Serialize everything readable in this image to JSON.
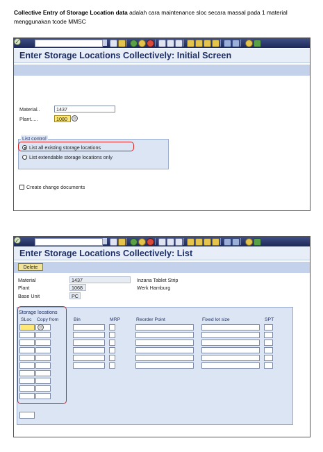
{
  "intro": {
    "bold": "Collective Entry of Storage Location data",
    "rest": " adalah cara maintenance sloc secara massal pada 1 material menggunakan tcode MMSC"
  },
  "screen1": {
    "title": "Enter Storage Locations Collectively: Initial Screen",
    "material_label": "Material..",
    "material_value": "1437",
    "plant_label": "Plant.....",
    "plant_value": "1080",
    "list_control_title": "List control",
    "option_existing": "List all existing storage locations",
    "option_extendable": "List extendable storage locations only",
    "option_selected": "existing",
    "create_change_docs": "Create change documents"
  },
  "screen2": {
    "title": "Enter Storage Locations Collectively: List",
    "delete_button": "Delete",
    "material_label": "Material",
    "material_value": "1437",
    "material_desc": "Inzana Tablet Strip",
    "plant_label": "Plant",
    "plant_value": "1068",
    "plant_desc": "Werk Hamburg",
    "base_unit_label": "Base Unit",
    "base_unit_value": "PC",
    "storage_locations_title": "Storage locations",
    "columns": {
      "sloc": "SLoc",
      "copy_from": "Copy from",
      "bin": "Bin",
      "mrp": "MRP",
      "reorder_point": "Reorder Point",
      "fixed_lot_size": "Fixed lot size",
      "spt": "SPT"
    }
  },
  "toolbar_icons": [
    "enter-icon",
    "save-icon",
    "back-icon",
    "exit-icon",
    "cancel-icon",
    "print-icon",
    "find-icon",
    "find-next-icon",
    "first-page-icon",
    "prev-page-icon",
    "next-page-icon",
    "last-page-icon",
    "new-session-icon",
    "shortcut-icon",
    "help-icon",
    "layout-icon"
  ],
  "colors": {
    "title_blue": "#1f3068",
    "highlight_red": "#d92020",
    "required_yellow": "#fde878"
  }
}
